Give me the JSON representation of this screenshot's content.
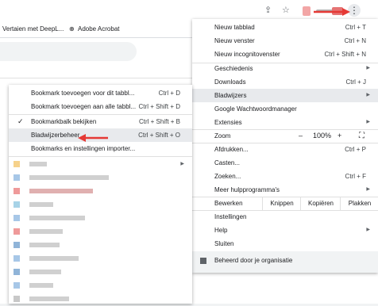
{
  "toolbar": {
    "share_icon": "share-icon",
    "star_icon": "star-icon",
    "menu_icon": "kebab-menu-icon",
    "menu_glyph": "⋮"
  },
  "bookmarks_bar": {
    "item1": "Vertaien met DeepL...",
    "item2": "Adobe Acrobat"
  },
  "main_menu": {
    "new_tab": "Nieuw tabblad",
    "new_tab_sc": "Ctrl + T",
    "new_window": "Nieuw venster",
    "new_window_sc": "Ctrl + N",
    "incognito": "Nieuw incognitovenster",
    "incognito_sc": "Ctrl + Shift + N",
    "history": "Geschiedenis",
    "downloads": "Downloads",
    "downloads_sc": "Ctrl + J",
    "bookmarks": "Bladwijzers",
    "password_manager": "Google Wachtwoordmanager",
    "extensions": "Extensies",
    "zoom": "Zoom",
    "zoom_minus": "–",
    "zoom_level": "100%",
    "zoom_plus": "+",
    "print": "Afdrukken...",
    "print_sc": "Ctrl + P",
    "cast": "Casten...",
    "find": "Zoeken...",
    "find_sc": "Ctrl + F",
    "more_tools": "Meer hulpprogramma's",
    "edit": "Bewerken",
    "cut": "Knippen",
    "copy": "Kopiëren",
    "paste": "Plakken",
    "settings": "Instellingen",
    "help": "Help",
    "exit": "Sluiten",
    "managed": "Beheerd door je organisatie"
  },
  "sub_menu": {
    "bookmark_tab": "Bookmark toevoegen voor dit tabbl...",
    "bookmark_tab_sc": "Ctrl + D",
    "bookmark_all": "Bookmark toevoegen aan alle tabbl...",
    "bookmark_all_sc": "Ctrl + Shift + D",
    "show_bar": "Bookmarkbalk bekijken",
    "show_bar_sc": "Ctrl + Shift + B",
    "manager": "Bladwijzerbeheer",
    "manager_sc": "Ctrl + Shift + O",
    "import": "Bookmarks en instellingen importer..."
  },
  "colors": {
    "accent_red": "#e53935",
    "highlight": "#e8eaed"
  }
}
